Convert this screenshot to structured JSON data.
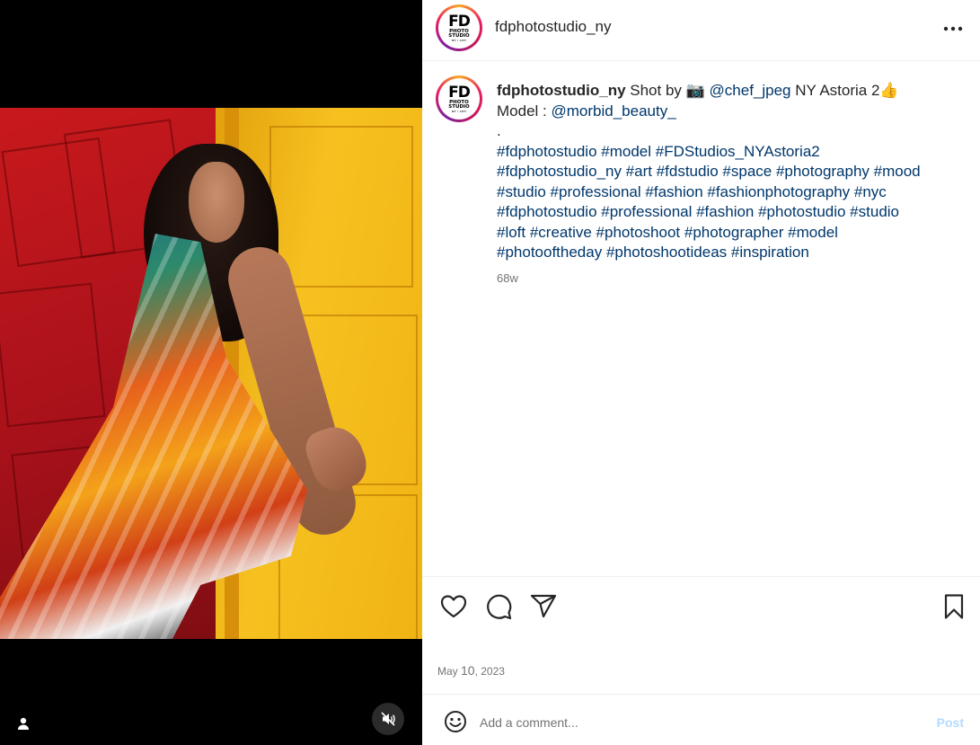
{
  "header": {
    "username": "fdphotostudio_ny",
    "avatar": {
      "logo_text": "FD",
      "logo_sub1": "PHOTO",
      "logo_sub2": "STUDIO",
      "logo_tiny": "NY • CITY"
    }
  },
  "caption": {
    "owner": "fdphotostudio_ny",
    "line1_text": " Shot by 📷  ",
    "mention_photographer": "@chef_jpeg",
    "line1_rest": " NY Astoria 2👍",
    "model_label": "Model : ",
    "mention_model": "@morbid_beauty_",
    "dot": ".",
    "hashtag_lines": [
      "#fdphotostudio #model #FDStudios_NYAstoria2",
      "#fdphotostudio_ny #art #fdstudio #space #photography #mood",
      "#studio #professional #fashion #fashionphotography #nyc",
      "#fdphotostudio #professional #fashion #photostudio #studio",
      "#loft #creative #photoshoot #photographer #model",
      "#photooftheday #photoshootideas  #inspiration"
    ],
    "time_ago": "68w"
  },
  "post_date": {
    "month": "May ",
    "day": "10",
    "year": ", 2023"
  },
  "comment": {
    "placeholder": "Add a comment...",
    "post_label": "Post"
  },
  "icons": {
    "more": "more-options-icon",
    "like": "heart-icon",
    "comment": "comment-icon",
    "share": "share-icon",
    "save": "bookmark-icon",
    "emoji": "emoji-icon",
    "user_tag": "user-icon",
    "mute": "muted-speaker-icon"
  },
  "colors": {
    "link": "#00376b",
    "muted_text": "#737373",
    "post_disabled": "#b3dbff"
  }
}
